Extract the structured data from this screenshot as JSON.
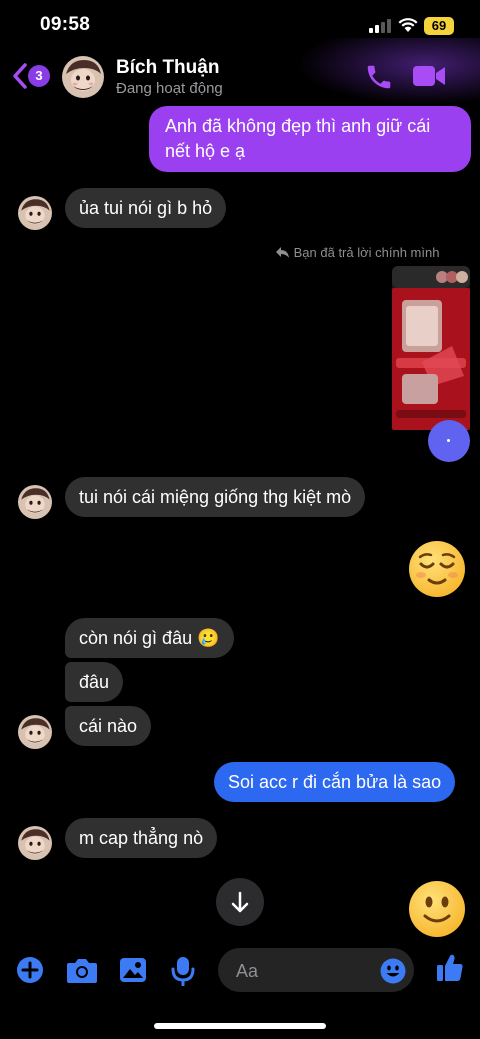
{
  "status_bar": {
    "time": "09:58",
    "battery": "69"
  },
  "header": {
    "back_badge_count": "3",
    "contact_name": "Bích Thuận",
    "contact_status": "Đang hoạt động"
  },
  "messages": [
    {
      "side": "out",
      "text": "Anh đã không đẹp thì anh giữ cái nết hộ e ạ"
    },
    {
      "side": "in",
      "text": "ủa tui nói gì b hỏ"
    },
    {
      "side": "out",
      "reply_note": "Bạn đã trả lời chính mình",
      "type": "image"
    },
    {
      "side": "in",
      "text": "tui nói cái miệng giống thg kiệt mò"
    },
    {
      "side": "out",
      "type": "emoji",
      "emoji": "relieved-face"
    },
    {
      "side": "in",
      "text": "còn nói gì đâu 🥲"
    },
    {
      "side": "in",
      "text": "đâu"
    },
    {
      "side": "in",
      "text": "cái nào"
    },
    {
      "side": "out",
      "text": "Soi acc r đi cắn bửa là sao"
    },
    {
      "side": "in",
      "text": "m cap thẳng nò"
    },
    {
      "side": "out",
      "type": "emoji",
      "emoji": "slightly-smiling-face"
    }
  ],
  "composer": {
    "placeholder": "Aa"
  },
  "colors": {
    "accent_purple": "#9b40f0",
    "accent_blue": "#2d69f0",
    "icon_blue": "#3d7bf5",
    "icon_purple": "#a84cf6",
    "incoming_bubble": "#303030"
  },
  "icons": [
    "back-chevron-icon",
    "phone-icon",
    "video-camera-icon",
    "reply-arrow-icon",
    "scroll-down-arrow-icon",
    "plus-icon",
    "camera-icon",
    "gallery-icon",
    "microphone-icon",
    "emoji-icon",
    "thumbs-up-icon"
  ]
}
